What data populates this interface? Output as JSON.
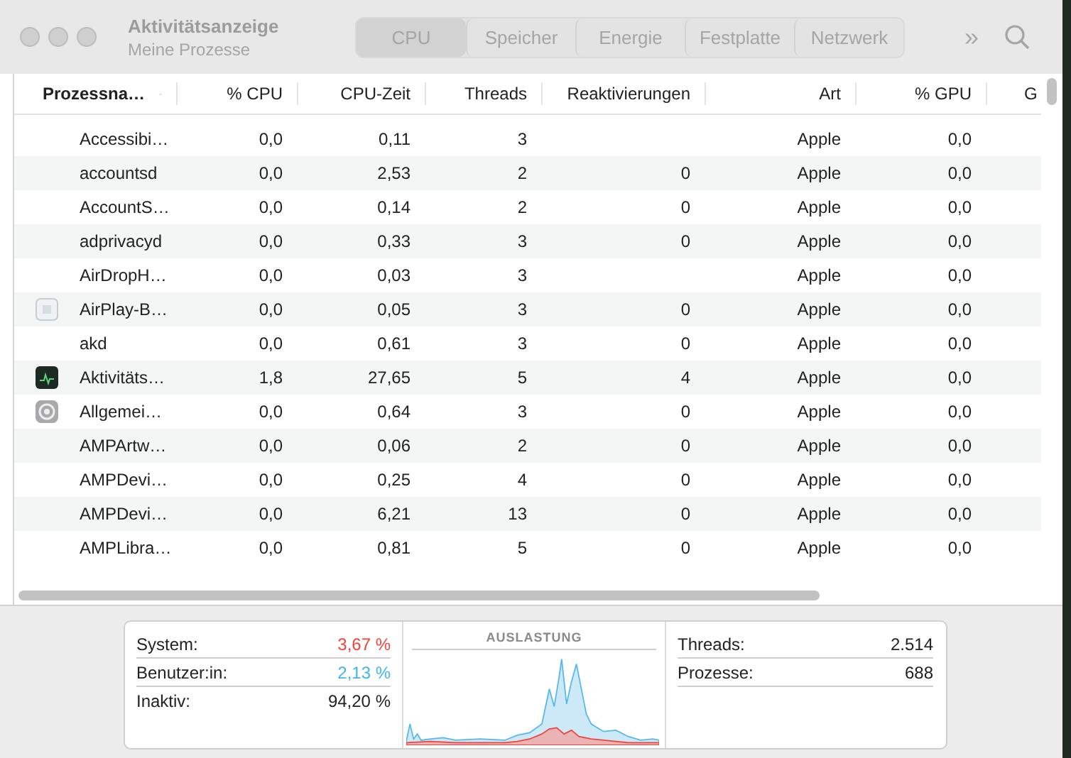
{
  "window": {
    "title": "Aktivitätsanzeige",
    "subtitle": "Meine Prozesse"
  },
  "tabs": [
    {
      "label": "CPU",
      "selected": true
    },
    {
      "label": "Speicher",
      "selected": false
    },
    {
      "label": "Energie",
      "selected": false
    },
    {
      "label": "Festplatte",
      "selected": false
    },
    {
      "label": "Netzwerk",
      "selected": false
    }
  ],
  "toolbar": {
    "more": "»"
  },
  "table": {
    "columns": [
      {
        "label": "Prozessna…",
        "sorted": true
      },
      {
        "label": "% CPU",
        "sorted": false
      },
      {
        "label": "CPU-Zeit",
        "sorted": false
      },
      {
        "label": "Threads",
        "sorted": false
      },
      {
        "label": "Reaktivierungen",
        "sorted": false
      },
      {
        "label": "Art",
        "sorted": false
      },
      {
        "label": "% GPU",
        "sorted": false
      },
      {
        "label": "G",
        "sorted": false
      }
    ],
    "rows": [
      {
        "kind": "plain",
        "cells": [
          "Accessibi…",
          "0,0",
          "0,11",
          "3",
          "",
          "Apple",
          "0,0"
        ]
      },
      {
        "kind": "plain",
        "cells": [
          "accountsd",
          "0,0",
          "2,53",
          "2",
          "0",
          "Apple",
          "0,0"
        ]
      },
      {
        "kind": "plain",
        "cells": [
          "AccountS…",
          "0,0",
          "0,14",
          "2",
          "0",
          "Apple",
          "0,0"
        ]
      },
      {
        "kind": "plain",
        "cells": [
          "adprivacyd",
          "0,0",
          "0,33",
          "3",
          "0",
          "Apple",
          "0,0"
        ]
      },
      {
        "kind": "plain",
        "cells": [
          "AirDropH…",
          "0,0",
          "0,03",
          "3",
          "",
          "Apple",
          "0,0"
        ]
      },
      {
        "kind": "tile",
        "cells": [
          "AirPlay-B…",
          "0,0",
          "0,05",
          "3",
          "0",
          "Apple",
          "0,0"
        ]
      },
      {
        "kind": "plain",
        "cells": [
          "akd",
          "0,0",
          "0,61",
          "3",
          "0",
          "Apple",
          "0,0"
        ]
      },
      {
        "kind": "monitor",
        "cells": [
          "Aktivitäts…",
          "1,8",
          "27,65",
          "5",
          "4",
          "Apple",
          "0,0"
        ]
      },
      {
        "kind": "gear",
        "cells": [
          "Allgemei…",
          "0,0",
          "0,64",
          "3",
          "0",
          "Apple",
          "0,0"
        ]
      },
      {
        "kind": "plain",
        "cells": [
          "AMPArtw…",
          "0,0",
          "0,06",
          "2",
          "0",
          "Apple",
          "0,0"
        ]
      },
      {
        "kind": "plain",
        "cells": [
          "AMPDevi…",
          "0,0",
          "0,25",
          "4",
          "0",
          "Apple",
          "0,0"
        ]
      },
      {
        "kind": "plain",
        "cells": [
          "AMPDevi…",
          "0,0",
          "6,21",
          "13",
          "0",
          "Apple",
          "0,0"
        ]
      },
      {
        "kind": "plain",
        "cells": [
          "AMPLibra…",
          "0,0",
          "0,81",
          "5",
          "0",
          "Apple",
          "0,0"
        ]
      }
    ]
  },
  "summary": {
    "cpu": [
      {
        "label": "System:",
        "value": "3,67 %",
        "color": "#f5433b"
      },
      {
        "label": "Benutzer:in:",
        "value": "2,13 %",
        "color": "#3fb5ee"
      },
      {
        "label": "Inaktiv:",
        "value": "94,20 %",
        "color": "#222222"
      }
    ],
    "chart_title": "AUSLASTUNG",
    "counts": [
      {
        "label": "Threads:",
        "value": "2.514"
      },
      {
        "label": "Prozesse:",
        "value": "688"
      }
    ]
  }
}
